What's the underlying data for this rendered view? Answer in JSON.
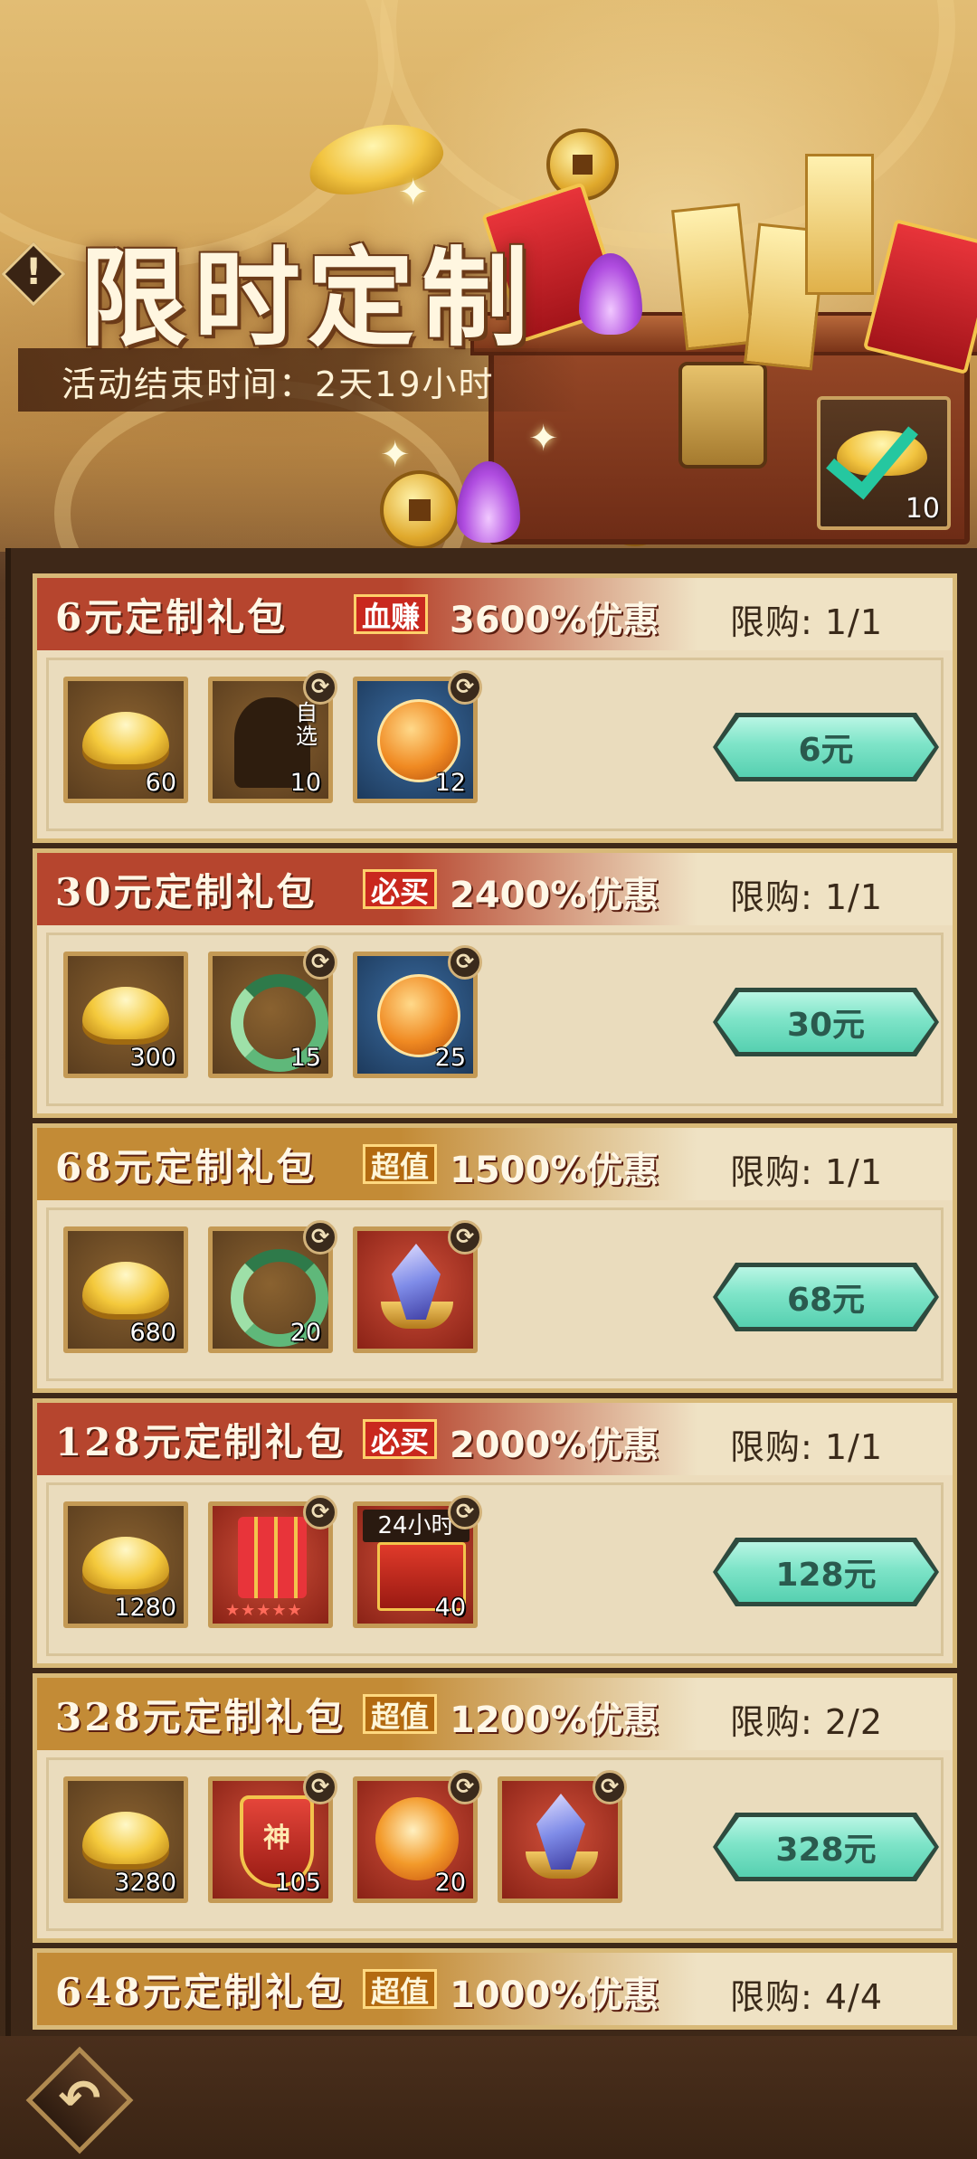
{
  "header": {
    "title": "限时定制",
    "end_time_text": "活动结束时间：2天19小时",
    "checkin_count": "10"
  },
  "packs": [
    {
      "name": "6元定制礼包",
      "tag": "血赚",
      "discount": "3600%优惠",
      "limit": "限购: 1/1",
      "price": "6元",
      "items": [
        {
          "icon": "gold-ingot-icon",
          "count": "60"
        },
        {
          "icon": "optional-hero-icon",
          "count": "10",
          "note": "自选"
        },
        {
          "icon": "dragon-orb-icon",
          "count": "12"
        }
      ]
    },
    {
      "name": "30元定制礼包",
      "tag": "必买",
      "discount": "2400%优惠",
      "limit": "限购: 1/1",
      "price": "30元",
      "items": [
        {
          "icon": "gold-ingot-icon",
          "count": "300"
        },
        {
          "icon": "jade-ring-icon",
          "count": "15"
        },
        {
          "icon": "dragon-orb-icon",
          "count": "25"
        }
      ]
    },
    {
      "name": "68元定制礼包",
      "tag": "超值",
      "discount": "1500%优惠",
      "limit": "限购: 1/1",
      "price": "68元",
      "items": [
        {
          "icon": "gold-ingot-icon",
          "count": "680"
        },
        {
          "icon": "jade-ring-icon",
          "count": "20"
        },
        {
          "icon": "crystal-icon",
          "count": ""
        }
      ]
    },
    {
      "name": "128元定制礼包",
      "tag": "必买",
      "discount": "2000%优惠",
      "limit": "限购: 1/1",
      "price": "128元",
      "items": [
        {
          "icon": "gold-ingot-icon",
          "count": "1280"
        },
        {
          "icon": "firecracker-icon",
          "count": "",
          "stars": "★★★★★"
        },
        {
          "icon": "gift-box-icon",
          "count": "40",
          "timer": "24小时"
        }
      ]
    },
    {
      "name": "328元定制礼包",
      "tag": "超值",
      "discount": "1200%优惠",
      "limit": "限购: 2/2",
      "price": "328元",
      "items": [
        {
          "icon": "gold-ingot-icon",
          "count": "3280"
        },
        {
          "icon": "god-shield-icon",
          "count": "105",
          "glyph": "神"
        },
        {
          "icon": "fire-orb-icon",
          "count": "20"
        },
        {
          "icon": "crystal-icon",
          "count": ""
        }
      ]
    },
    {
      "name": "648元定制礼包",
      "tag": "超值",
      "discount": "1000%优惠",
      "limit": "限购: 4/4"
    }
  ],
  "colors": {
    "red_band": "#b6452e",
    "gold_band": "#c38b36",
    "buy_button": "#7ee4c8"
  }
}
